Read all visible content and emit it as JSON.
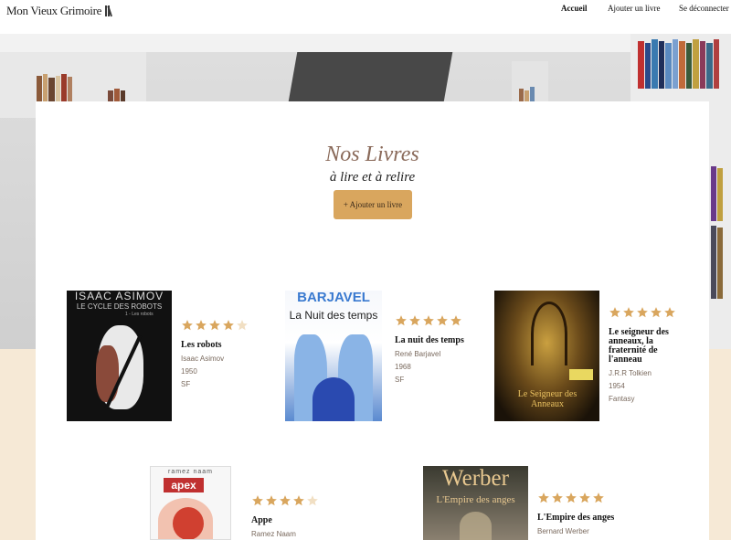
{
  "brand": {
    "name": "Mon Vieux Grimoire"
  },
  "nav": {
    "home": "Accueil",
    "add": "Ajouter un livre",
    "logout": "Se déconnecter"
  },
  "hero": {
    "title": "Nos Livres",
    "subtitle": "à lire et à relire",
    "add_button": "+ Ajouter un livre"
  },
  "colors": {
    "accent": "#d9a65e",
    "star_on": "#d9a65e",
    "star_off": "#f1dfc3",
    "title": "#8a6a5a",
    "page_bg": "#f6e9d6"
  },
  "books": [
    {
      "title": "Les robots",
      "author": "Isaac Asimov",
      "year": "1950",
      "genre": "SF",
      "rating": 4,
      "cover_text": [
        "ISAAC ASIMOV",
        "LE CYCLE DES ROBOTS",
        "1 - Les robots"
      ]
    },
    {
      "title": "La nuit des temps",
      "author": "René Barjavel",
      "year": "1968",
      "genre": "SF",
      "rating": 5,
      "cover_text": [
        "BARJAVEL",
        "La Nuit des temps"
      ]
    },
    {
      "title": "Le seigneur des anneaux, la fraternité de l'anneau",
      "author": "J.R.R Tolkien",
      "year": "1954",
      "genre": "Fantasy",
      "rating": 5,
      "cover_text": [
        "Le Seigneur des Anneaux"
      ]
    },
    {
      "title": "Appe",
      "author": "Ramez Naam",
      "year": "",
      "genre": "",
      "rating": 4,
      "cover_text": [
        "ramez naam",
        "apex"
      ]
    },
    {
      "title": "L'Empire des anges",
      "author": "Bernard Werber",
      "year": "",
      "genre": "",
      "rating": 5,
      "cover_text": [
        "Werber",
        "L'Empire des anges"
      ]
    }
  ]
}
